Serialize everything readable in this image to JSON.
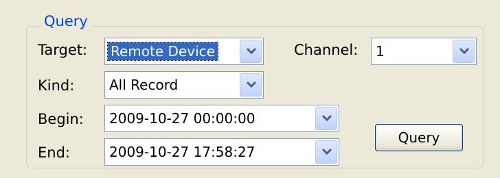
{
  "query_group": {
    "title": "Query",
    "target": {
      "label": "Target:",
      "value": "Remote Device"
    },
    "channel": {
      "label": "Channel:",
      "value": "1"
    },
    "kind": {
      "label": "Kind:",
      "value": "All Record"
    },
    "begin": {
      "label": "Begin:",
      "value": "2009-10-27 00:00:00"
    },
    "end": {
      "label": "End:",
      "value": "2009-10-27 17:58:27"
    },
    "query_button_label": "Query"
  },
  "colors": {
    "legend": "#0046d5",
    "selection": "#316ac5",
    "combo_border": "#7f9db9",
    "background": "#ece9d8"
  },
  "icons": {
    "dropdown": "chevron-down-icon"
  }
}
